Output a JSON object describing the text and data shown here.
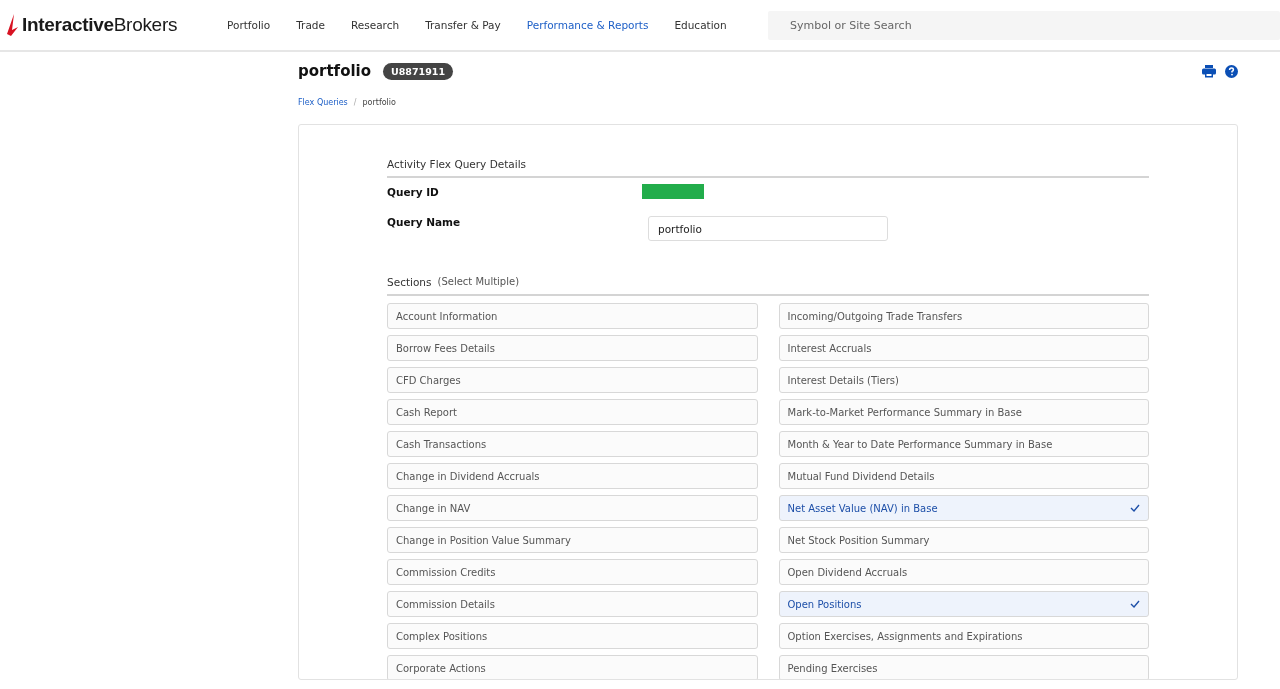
{
  "header": {
    "logo": "**Interactive**Brokers",
    "nav": [
      {
        "label": "Portfolio",
        "selected": false
      },
      {
        "label": "Trade",
        "selected": false
      },
      {
        "label": "Research",
        "selected": false
      },
      {
        "label": "Transfer & Pay",
        "selected": false
      },
      {
        "label": "Performance & Reports",
        "selected": true
      },
      {
        "label": "Education",
        "selected": false
      }
    ],
    "search": {
      "placeholder": "Symbol or Site Search"
    }
  },
  "page": {
    "title": "portfolio",
    "account_badge": "U8871911",
    "breadcrumb_separator": "/",
    "breadcrumb": [
      {
        "label": "Flex Queries",
        "kind": "link"
      },
      {
        "label": "portfolio",
        "kind": "current"
      }
    ]
  },
  "details": {
    "heading": "Activity Flex Query Details",
    "query_id_label": "Query ID",
    "query_name_label": "Query Name",
    "query_name_value": "portfolio"
  },
  "sections": {
    "heading": "Sections",
    "hint": "(Select Multiple)",
    "items": [
      {
        "label": "Account Information",
        "selected": false
      },
      {
        "label": "Incoming/Outgoing Trade Transfers",
        "selected": false
      },
      {
        "label": "Borrow Fees Details",
        "selected": false
      },
      {
        "label": "Interest Accruals",
        "selected": false
      },
      {
        "label": "CFD Charges",
        "selected": false
      },
      {
        "label": "Interest Details (Tiers)",
        "selected": false
      },
      {
        "label": "Cash Report",
        "selected": false
      },
      {
        "label": "Mark-to-Market Performance Summary in Base",
        "selected": false
      },
      {
        "label": "Cash Transactions",
        "selected": false
      },
      {
        "label": "Month & Year to Date Performance Summary in Base",
        "selected": false
      },
      {
        "label": "Change in Dividend Accruals",
        "selected": false
      },
      {
        "label": "Mutual Fund Dividend Details",
        "selected": false
      },
      {
        "label": "Change in NAV",
        "selected": false
      },
      {
        "label": "Net Asset Value (NAV) in Base",
        "selected": true
      },
      {
        "label": "Change in Position Value Summary",
        "selected": false
      },
      {
        "label": "Net Stock Position Summary",
        "selected": false
      },
      {
        "label": "Commission Credits",
        "selected": false
      },
      {
        "label": "Open Dividend Accruals",
        "selected": false
      },
      {
        "label": "Commission Details",
        "selected": false
      },
      {
        "label": "Open Positions",
        "selected": true
      },
      {
        "label": "Complex Positions",
        "selected": false
      },
      {
        "label": "Option Exercises, Assignments and Expirations",
        "selected": false
      },
      {
        "label": "Corporate Actions",
        "selected": false
      },
      {
        "label": "Pending Exercises",
        "selected": false
      }
    ]
  }
}
